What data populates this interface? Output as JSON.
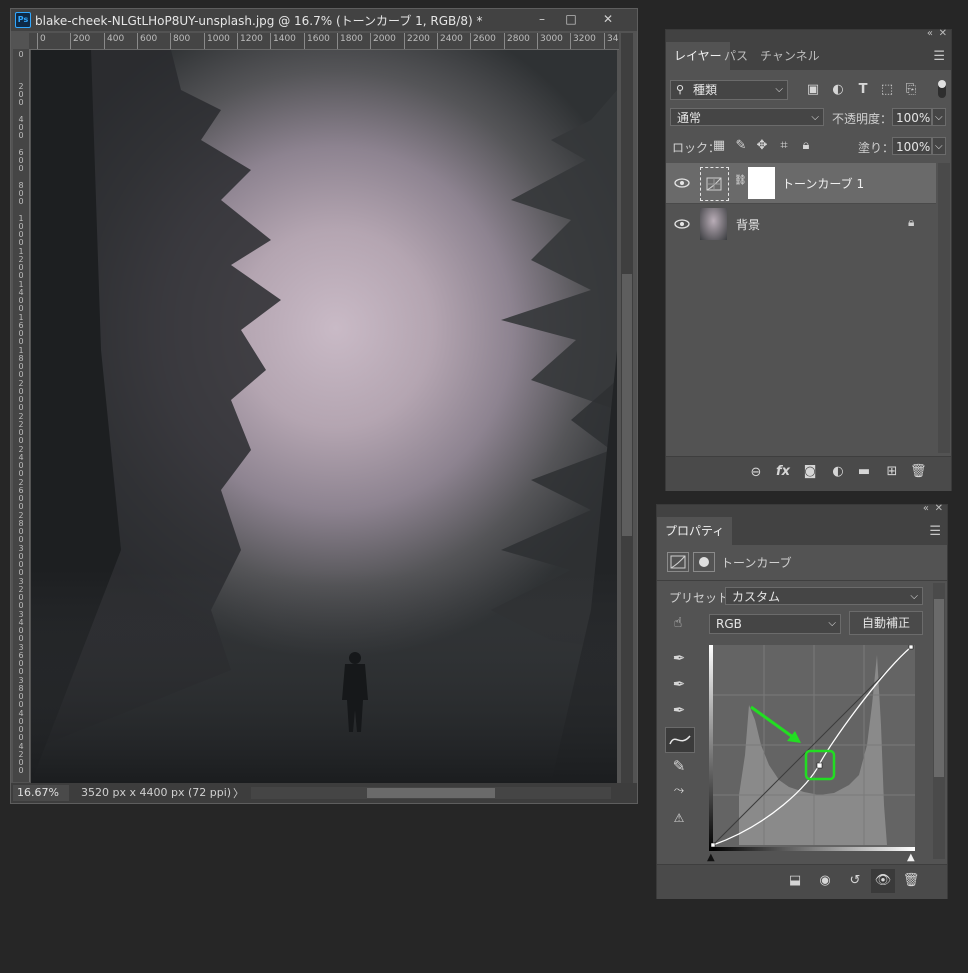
{
  "document": {
    "title": "blake-cheek-NLGtLHoP8UY-unsplash.jpg @ 16.7% (トーンカーブ 1, RGB/8) *",
    "app_icon": "Ps",
    "window_buttons": [
      "–",
      "□",
      "✕"
    ],
    "ruler_top_labels": [
      "0",
      "200",
      "400",
      "600",
      "800",
      "1000",
      "1200",
      "1400",
      "1600",
      "1800",
      "2000",
      "2200",
      "2400",
      "2600",
      "2800",
      "3000",
      "3200",
      "340"
    ],
    "ruler_left_labels": [
      "0",
      "2 0 0",
      "4 0 0",
      "6 0 0",
      "8 0 0",
      "1 0 0 0",
      "1 2 0 0",
      "1 4 0 0",
      "1 6 0 0",
      "1 8 0 0",
      "2 0 0 0",
      "2 2 0 0",
      "2 4 0 0",
      "2 6 0 0",
      "2 8 0 0",
      "3 0 0 0",
      "3 2 0 0",
      "3 4 0 0",
      "3 6 0 0",
      "3 8 0 0",
      "4 0 0 0",
      "4 2 0 0"
    ],
    "zoom": "16.67%",
    "doc_size": "3520 px x 4400 px (72 ppi)",
    "status_arrow": "〉"
  },
  "layers_panel": {
    "tabs": [
      "レイヤー",
      "パス",
      "チャンネル"
    ],
    "filter_kind": "種類",
    "blend_mode": "通常",
    "opacity_label": "不透明度：",
    "opacity_value": "100%",
    "lock_label": "ロック：",
    "fill_label": "塗り：",
    "fill_value": "100%",
    "layers": [
      {
        "name": "トーンカーブ 1",
        "selected": true,
        "visible": true
      },
      {
        "name": "背景",
        "selected": false,
        "visible": true,
        "locked": true
      }
    ],
    "icons": {
      "link": "link-icon",
      "fx": "fx",
      "mask": "mask-icon",
      "adjustment": "adjustment-icon",
      "group": "folder-icon",
      "new": "new-layer-icon",
      "delete": "trash-icon"
    }
  },
  "properties_panel": {
    "tab": "プロパティ",
    "header": "トーンカーブ",
    "preset_label": "プリセット：",
    "preset_value": "カスタム",
    "channel": "RGB",
    "auto_button": "自動補正",
    "accent_color": "#22dd22"
  }
}
